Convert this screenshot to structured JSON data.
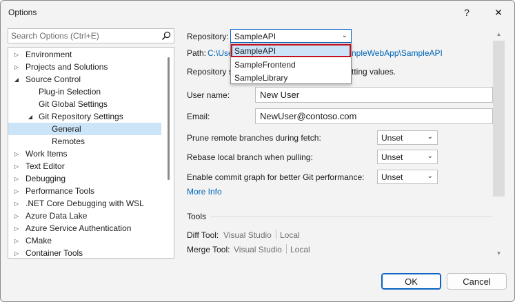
{
  "window": {
    "title": "Options",
    "help_glyph": "?",
    "close_glyph": "✕"
  },
  "search": {
    "placeholder": "Search Options (Ctrl+E)"
  },
  "tree": {
    "items": [
      {
        "label": "Environment",
        "arrow": "▷"
      },
      {
        "label": "Projects and Solutions",
        "arrow": "▷"
      },
      {
        "label": "Source Control",
        "arrow": "◢"
      },
      {
        "label": "Plug-in Selection",
        "arrow": ""
      },
      {
        "label": "Git Global Settings",
        "arrow": ""
      },
      {
        "label": "Git Repository Settings",
        "arrow": "◢"
      },
      {
        "label": "General",
        "arrow": "",
        "selected": true
      },
      {
        "label": "Remotes",
        "arrow": ""
      },
      {
        "label": "Work Items",
        "arrow": "▷"
      },
      {
        "label": "Text Editor",
        "arrow": "▷"
      },
      {
        "label": "Debugging",
        "arrow": "▷"
      },
      {
        "label": "Performance Tools",
        "arrow": "▷"
      },
      {
        "label": ".NET Core Debugging with WSL",
        "arrow": "▷"
      },
      {
        "label": "Azure Data Lake",
        "arrow": "▷"
      },
      {
        "label": "Azure Service Authentication",
        "arrow": "▷"
      },
      {
        "label": "CMake",
        "arrow": "▷"
      },
      {
        "label": "Container Tools",
        "arrow": "▷"
      }
    ]
  },
  "repo": {
    "label": "Repository:",
    "selected": "SampleAPI",
    "chevron": "⌄",
    "options": [
      "SampleAPI",
      "SampleFrontend",
      "SampleLibrary"
    ]
  },
  "path": {
    "label": "Path:",
    "value_start": "C:\\Use",
    "value_end": "nple​WebApp\\SampleAPI"
  },
  "repo_settings_text": {
    "start": "Repository s",
    "end": "tting values."
  },
  "user": {
    "label": "User name:",
    "value": "New User"
  },
  "email": {
    "label": "Email:",
    "value": "NewUser@contoso.com"
  },
  "options": {
    "prune": {
      "label": "Prune remote branches during fetch:",
      "value": "Unset"
    },
    "rebase": {
      "label": "Rebase local branch when pulling:",
      "value": "Unset"
    },
    "graph": {
      "label": "Enable commit graph for better Git performance:",
      "value": "Unset"
    },
    "chevron": "⌄"
  },
  "more_info": "More Info",
  "tools": {
    "heading": "Tools",
    "diff": {
      "label": "Diff Tool:",
      "opt1": "Visual Studio",
      "opt2": "Local"
    },
    "merge": {
      "label": "Merge Tool:",
      "opt1": "Visual Studio",
      "opt2": "Local"
    }
  },
  "buttons": {
    "ok": "OK",
    "cancel": "Cancel"
  },
  "colors": {
    "accent": "#0a63c5",
    "link": "#0066b8",
    "selection": "#cce4f7",
    "highlight_border": "#c50f1f"
  }
}
